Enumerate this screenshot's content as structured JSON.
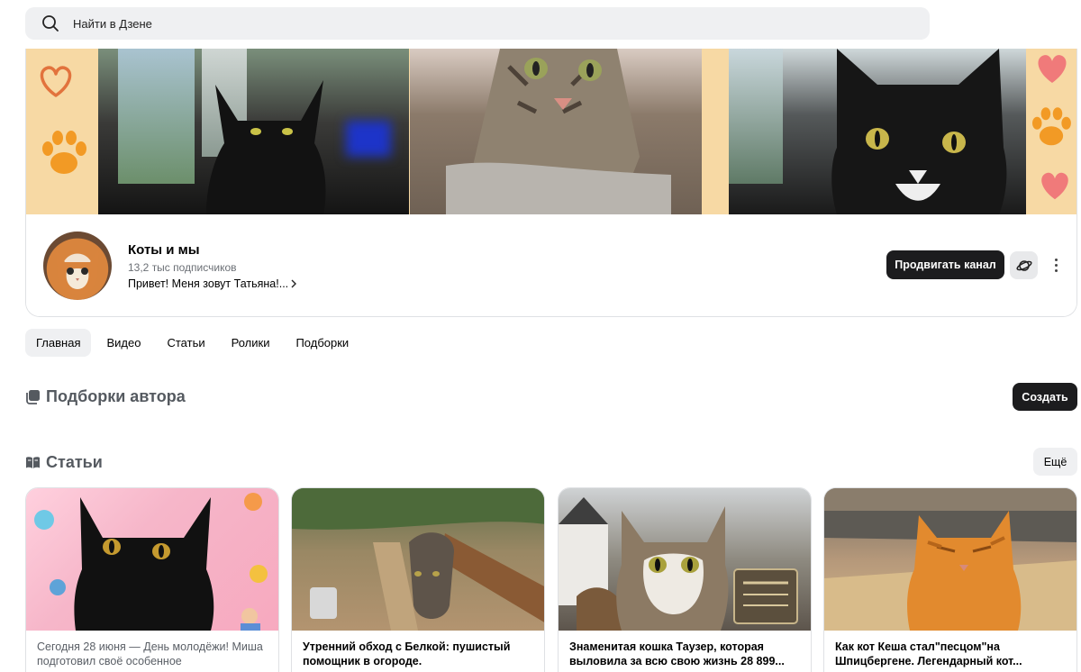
{
  "search": {
    "placeholder": "Найти в Дзене"
  },
  "channel": {
    "title": "Коты и мы",
    "subscribers": "13,2 тыс подписчиков",
    "description": "Привет! Меня зовут Татьяна!...",
    "promote_label": "Продвигать канал"
  },
  "tabs": [
    {
      "label": "Главная",
      "active": true
    },
    {
      "label": "Видео",
      "active": false
    },
    {
      "label": "Статьи",
      "active": false
    },
    {
      "label": "Ролики",
      "active": false
    },
    {
      "label": "Подборки",
      "active": false
    }
  ],
  "collections": {
    "title": "Подборки автора",
    "create_label": "Создать"
  },
  "articles": {
    "title": "Статьи",
    "more_label": "Ещё",
    "items": [
      {
        "text": "Сегодня 28 июня — День молодёжи! Миша подготовил своё особенное"
      },
      {
        "text": "Утренний обход с Белкой: пушистый помощник в огороде."
      },
      {
        "text": "Знаменитая кошка Таузер, которая выловила за всю свою жизнь 28 899..."
      },
      {
        "text": "Как кот Кеша стал\"песцом\"на Шпицбергене. Легендарный кот..."
      }
    ]
  },
  "colors": {
    "dark_button": "#1c1c1e",
    "tab_active_bg": "#eff0f2",
    "search_bg": "#eff0f2"
  },
  "icons": {
    "search": "search-icon",
    "planet": "planet-icon",
    "more": "more-vertical-icon",
    "collections": "collections-icon",
    "articles": "articles-icon",
    "chevron": "chevron-right-icon"
  }
}
